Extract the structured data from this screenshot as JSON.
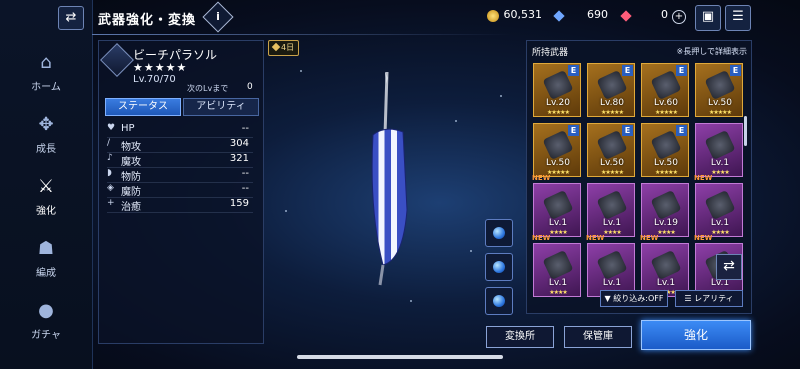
{
  "header": {
    "title": "武器強化・変換",
    "info_icon": "i"
  },
  "currency": {
    "gold": "60,531",
    "crystal": "690",
    "gem": "0"
  },
  "nav": {
    "items": [
      {
        "label": "ホーム",
        "icon": "house-icon"
      },
      {
        "label": "成長",
        "icon": "growth-icon"
      },
      {
        "label": "強化",
        "icon": "sword-icon"
      },
      {
        "label": "編成",
        "icon": "party-icon"
      },
      {
        "label": "ガチャ",
        "icon": "gacha-icon"
      }
    ]
  },
  "weapon": {
    "name": "ビーチパラソル",
    "stars": "★★★★★",
    "level": "Lv.70/70",
    "next_label": "次のLvまで",
    "next_value": "0",
    "tabs": {
      "status": "ステータス",
      "ability": "アビリティ"
    },
    "stats": [
      {
        "label": "HP",
        "value": "--"
      },
      {
        "label": "物攻",
        "value": "304"
      },
      {
        "label": "魔攻",
        "value": "321"
      },
      {
        "label": "物防",
        "value": "--"
      },
      {
        "label": "魔防",
        "value": "--"
      },
      {
        "label": "治癒",
        "value": "159"
      }
    ],
    "days_badge": "4日"
  },
  "owned": {
    "title": "所持武器",
    "hint": "※長押しで詳細表示",
    "slots": [
      {
        "rarity": "gold",
        "level": "Lv.20",
        "stars": "★★★★★",
        "equipped": "E",
        "new": ""
      },
      {
        "rarity": "gold",
        "level": "Lv.80",
        "stars": "★★★★★",
        "equipped": "E",
        "new": ""
      },
      {
        "rarity": "gold",
        "level": "Lv.60",
        "stars": "★★★★★",
        "equipped": "E",
        "new": ""
      },
      {
        "rarity": "gold",
        "level": "Lv.50",
        "stars": "★★★★★",
        "equipped": "E",
        "new": ""
      },
      {
        "rarity": "gold",
        "level": "Lv.50",
        "stars": "★★★★★",
        "equipped": "E",
        "new": ""
      },
      {
        "rarity": "gold",
        "level": "Lv.50",
        "stars": "★★★★★",
        "equipped": "E",
        "new": ""
      },
      {
        "rarity": "gold",
        "level": "Lv.50",
        "stars": "★★★★★",
        "equipped": "E",
        "new": ""
      },
      {
        "rarity": "purple",
        "level": "Lv.1",
        "stars": "★★★★",
        "equipped": "",
        "new": ""
      },
      {
        "rarity": "purple",
        "level": "Lv.1",
        "stars": "★★★★",
        "equipped": "",
        "new": "NEW"
      },
      {
        "rarity": "purple",
        "level": "Lv.1",
        "stars": "★★★★",
        "equipped": "",
        "new": ""
      },
      {
        "rarity": "purple",
        "level": "Lv.19",
        "stars": "★★★★",
        "equipped": "",
        "new": ""
      },
      {
        "rarity": "purple",
        "level": "Lv.1",
        "stars": "★★★★",
        "equipped": "",
        "new": "NEW"
      },
      {
        "rarity": "purple",
        "level": "Lv.1",
        "stars": "★★★★",
        "equipped": "",
        "new": "NEW"
      },
      {
        "rarity": "purple",
        "level": "Lv.1",
        "stars": "★★★★",
        "equipped": "",
        "new": "NEW"
      },
      {
        "rarity": "purple",
        "level": "Lv.1",
        "stars": "★★★★",
        "equipped": "",
        "new": "NEW"
      },
      {
        "rarity": "purple",
        "level": "Lv.1",
        "stars": "★★★★",
        "equipped": "",
        "new": "NEW"
      }
    ],
    "filter_label": "絞り込み:OFF",
    "sort_label": "レアリティ"
  },
  "buttons": {
    "exchange": "変換所",
    "storage": "保管庫",
    "enhance": "強化"
  },
  "colors": {
    "accent": "#2f7ae8",
    "gold_frame": "#c48a20",
    "purple_frame": "#8e3fa8"
  }
}
